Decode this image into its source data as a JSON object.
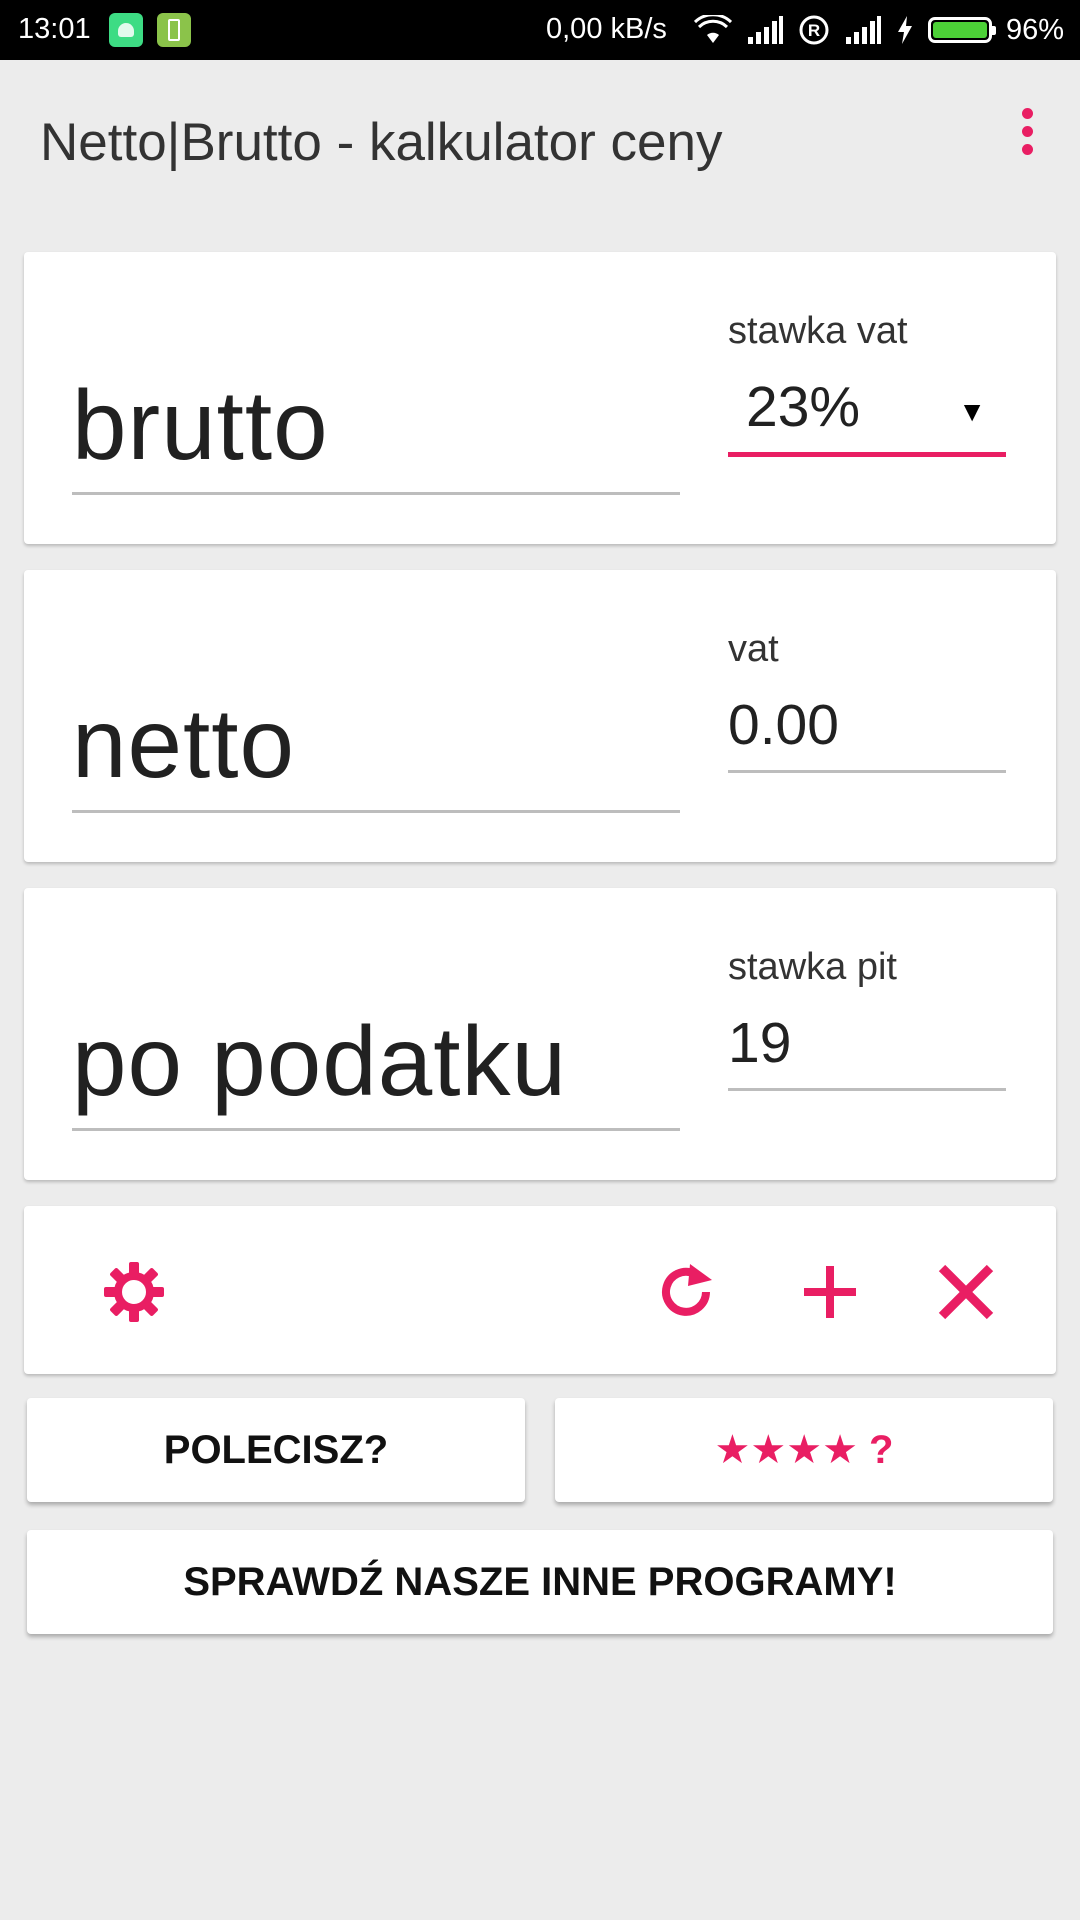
{
  "status_bar": {
    "time": "13:01",
    "speed": "0,00 kB/s",
    "battery_percent": "96%",
    "battery_level": 0.96
  },
  "app_bar": {
    "title": "Netto|Brutto - kalkulator ceny",
    "overflow_icon": "more-vert-icon"
  },
  "fields": {
    "brutto_placeholder": "brutto",
    "vat_rate_label": "stawka vat",
    "vat_rate_value": "23%",
    "netto_placeholder": "netto",
    "vat_label": "vat",
    "vat_value": "0.00",
    "po_podatku_placeholder": "po podatku",
    "pit_rate_label": "stawka pit",
    "pit_rate_value": "19"
  },
  "actions": {
    "settings_icon": "gear-icon",
    "refresh_icon": "refresh-icon",
    "add_icon": "plus-icon",
    "clear_icon": "close-icon"
  },
  "buttons": {
    "recommend": "POLECISZ?",
    "rate": "★★★★ ?",
    "other_programs": "SPRAWDŹ NASZE INNE PROGRAMY!"
  },
  "colors": {
    "accent": "#e91e63",
    "background": "#ececec"
  }
}
